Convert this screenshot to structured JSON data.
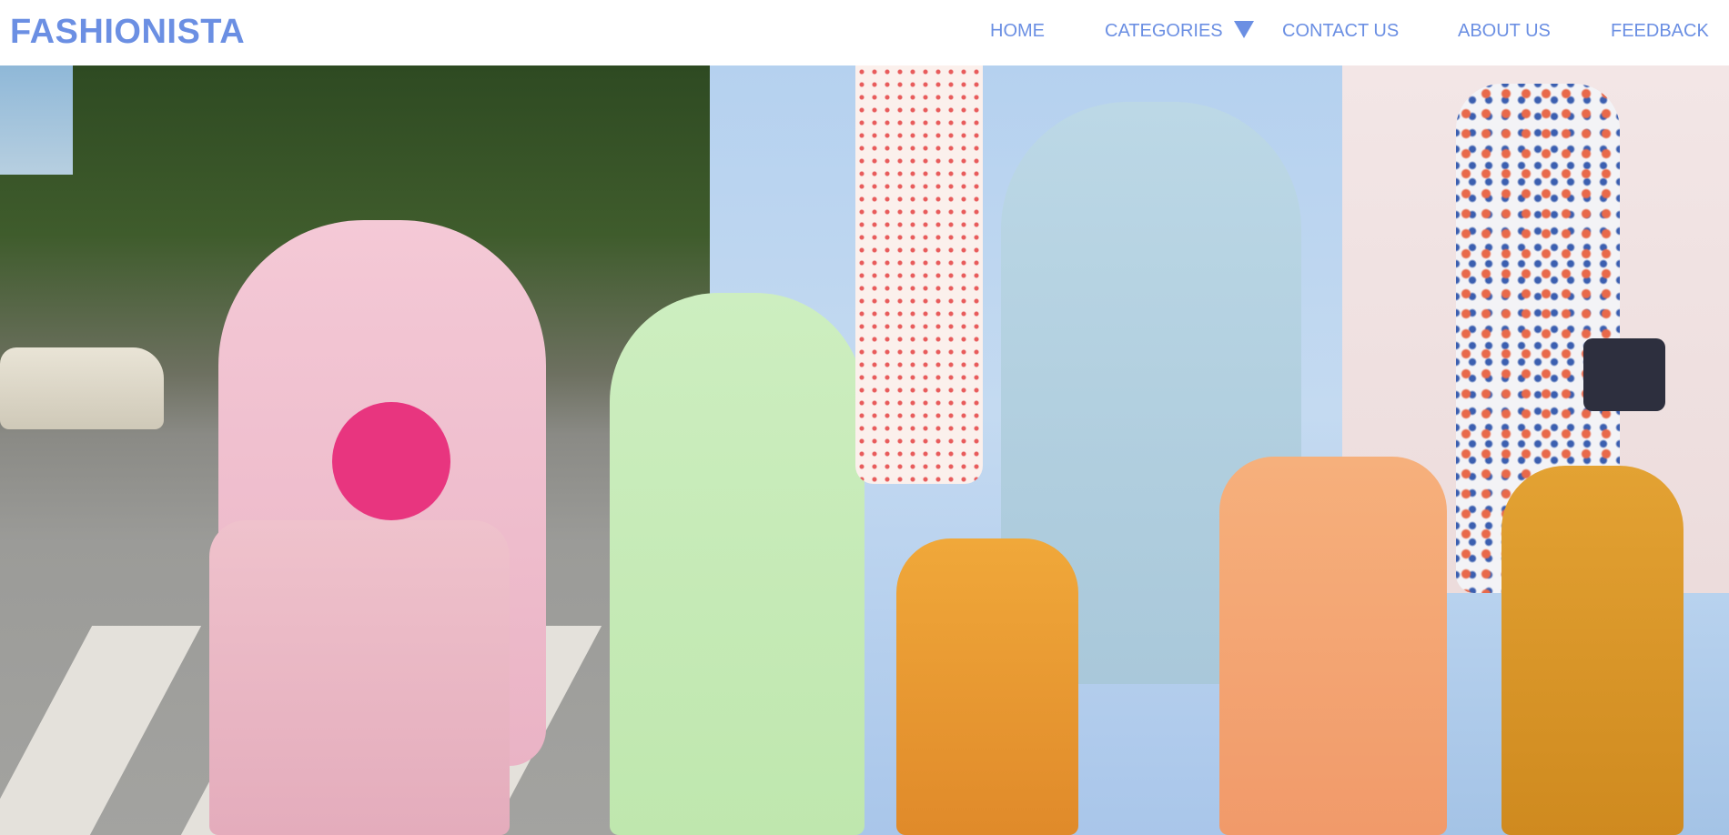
{
  "brand": {
    "name": "FASHIONISTA"
  },
  "nav": {
    "home": "HOME",
    "categories": "CATEGORIES",
    "contact": "CONTACT US",
    "about": "ABOUT US",
    "feedback": "FEEDBACK"
  },
  "icons": {
    "categories_dropdown": "caret-down-icon"
  },
  "colors": {
    "accent": "#6b8fe3",
    "navbar_background": "#ffffff"
  },
  "hero": {
    "image": "fashion-collage"
  }
}
